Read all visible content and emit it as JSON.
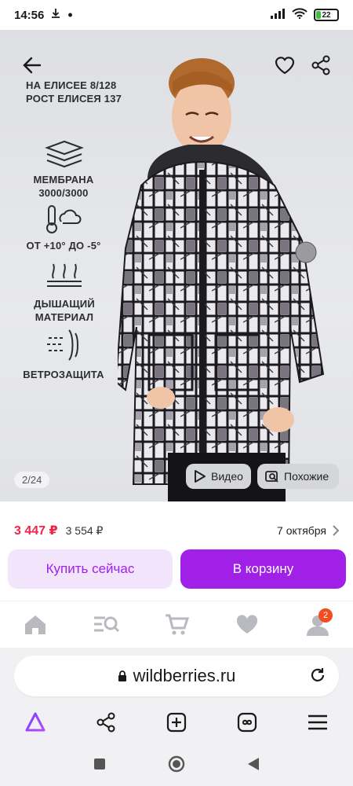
{
  "status": {
    "time": "14:56",
    "battery": "22"
  },
  "product": {
    "size_info_line1": "НА ЕЛИСЕЕ 8/128",
    "size_info_line2": "РОСТ ЕЛИСЕЯ 137",
    "features": [
      {
        "icon": "membrane-layers-icon",
        "label_line1": "МЕМБРАНА",
        "label_line2": "3000/3000"
      },
      {
        "icon": "thermometer-cloud-icon",
        "label_line1": "ОТ +10° ДО -5°",
        "label_line2": ""
      },
      {
        "icon": "breathable-arrows-icon",
        "label_line1": "ДЫШАЩИЙ",
        "label_line2": "МАТЕРИАЛ"
      },
      {
        "icon": "wind-protection-icon",
        "label_line1": "ВЕТРОЗАЩИТА",
        "label_line2": ""
      }
    ],
    "image_counter": "2/24",
    "video_label": "Видео",
    "similar_label": "Похожие",
    "price_current": "3 447 ₽",
    "price_old": "3 554 ₽",
    "delivery_date": "7 октября",
    "buy_now_label": "Купить сейчас",
    "add_to_cart_label": "В корзину"
  },
  "app_nav": {
    "items": [
      "home-icon",
      "search-catalog-icon",
      "cart-icon",
      "favorites-icon",
      "profile-icon"
    ],
    "profile_badge": "2"
  },
  "browser": {
    "url": "wildberries.ru"
  },
  "colors": {
    "accent": "#a020e8",
    "price": "#f0234b",
    "badge": "#f24c1f"
  }
}
